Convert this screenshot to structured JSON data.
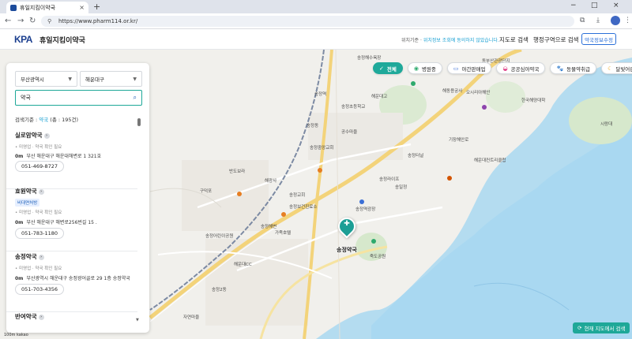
{
  "browser": {
    "tab_title": "휴일지킴이약국",
    "url": "https://www.pharm114.or.kr/",
    "new_tab_glyph": "+",
    "controls": [
      "−",
      "□",
      "×"
    ]
  },
  "header": {
    "logo_text": "KPA",
    "site_name": "휴일지킴이약국",
    "location_note_prefix": "위치기준 · ",
    "location_note_highlight": "위치정보 조회에 동의하지 않았습니다.",
    "map_search": "지도로 검색",
    "admin_search": "행정구역으로 검색",
    "register_button": "약국정보수정"
  },
  "filters": {
    "chips": [
      {
        "label": "전체",
        "icon": "✓",
        "active": true
      },
      {
        "label": "병원중",
        "icon": "◉",
        "active": false
      },
      {
        "label": "야간판매업",
        "icon": "▭",
        "active": false
      },
      {
        "label": "공공심야약국",
        "icon": "◒",
        "active": false
      },
      {
        "label": "동물약취급",
        "icon": "🐾",
        "active": false
      },
      {
        "label": "달빛어린이약국",
        "icon": "☾",
        "active": false
      }
    ]
  },
  "sidebar": {
    "region": "부산광역시",
    "district": "해운대구",
    "search_value": "약국",
    "criteria_prefix": "검색기준 : ",
    "criteria_keyword": "약국",
    "criteria_count": "(총 : 195건)",
    "results": [
      {
        "name": "실로암약국",
        "badge": "",
        "hours": "• 미영업 · 약국 확인 필요",
        "distance": "0m",
        "address": "부산 해운대구 해운대해변로 1 321호",
        "phone": "051-469-8727"
      },
      {
        "name": "효원약국",
        "badge": "비대면처방",
        "hours": "• 미영업 · 약국 확인 필요",
        "distance": "0m",
        "address": "부산 해운대구 해변로256번길 15 .",
        "phone": "051-783-1180"
      },
      {
        "name": "송정약국",
        "badge": "",
        "hours": "• 미영업 · 약국 확인 필요",
        "distance": "0m",
        "address": "부산광역시 해운대구 송정광어골로 29 1층 송정약국",
        "phone": "051-703-4356"
      },
      {
        "name": "반여약국",
        "badge": "",
        "hours": "",
        "distance": "",
        "address": "",
        "phone": ""
      }
    ]
  },
  "map": {
    "marker_label": "송정약국",
    "search_here": "현재 지도에서 검색",
    "scale": "100m  kakao",
    "labels": [
      "송정해수욕장",
      "송정역",
      "송정초등학교",
      "해운대고",
      "송정동",
      "공수마을",
      "송정중앙교회",
      "반도보라",
      "구덕포",
      "해광사",
      "송정어린이공원",
      "송정해변",
      "해동용궁사",
      "시랑대",
      "오시리아해안",
      "동부산관광단지",
      "기장해안로",
      "송정터널",
      "해운대컨트리클럽",
      "송정라이프",
      "죽도공원",
      "송일정",
      "송정교회",
      "송정보건진료소",
      "가족호텔",
      "해운대CC",
      "송정2동",
      "자연마을",
      "송정역광장",
      "한국해양대학"
    ],
    "colors": {
      "accent": "#1ea898",
      "sea": "#a9d8f1",
      "road": "#f3d37a"
    }
  }
}
